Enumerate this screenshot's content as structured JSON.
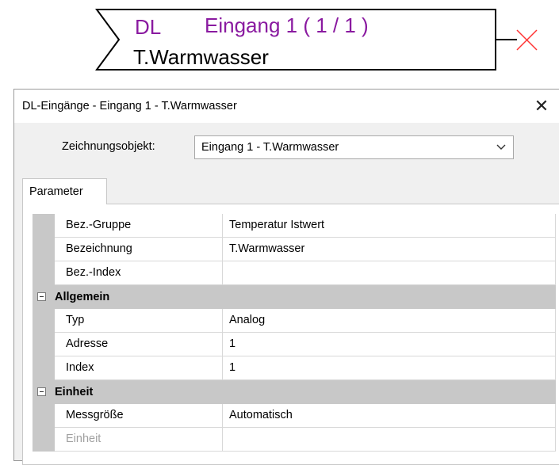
{
  "block": {
    "prefix": "DL",
    "title": "Eingang 1 ( 1 / 1 )",
    "name": "T.Warmwasser"
  },
  "dialog": {
    "title": "DL-Eingänge - Eingang 1 - T.Warmwasser",
    "close_icon": "✕",
    "drawing_object_label": "Zeichnungsobjekt:",
    "drawing_object_value": "Eingang 1 - T.Warmwasser",
    "tab_label": "Parameter"
  },
  "grid": {
    "rows": [
      {
        "type": "prop",
        "name": "Bez.-Gruppe",
        "value": "Temperatur Istwert"
      },
      {
        "type": "prop",
        "name": "Bezeichnung",
        "value": "T.Warmwasser"
      },
      {
        "type": "prop",
        "name": "Bez.-Index",
        "value": ""
      },
      {
        "type": "category",
        "name": "Allgemein"
      },
      {
        "type": "prop",
        "name": "Typ",
        "value": "Analog"
      },
      {
        "type": "prop",
        "name": "Adresse",
        "value": "1"
      },
      {
        "type": "prop",
        "name": "Index",
        "value": "1"
      },
      {
        "type": "category",
        "name": "Einheit"
      },
      {
        "type": "prop",
        "name": "Messgröße",
        "value": "Automatisch"
      },
      {
        "type": "prop",
        "name": "Einheit",
        "value": "",
        "disabled": true
      }
    ]
  },
  "colors": {
    "block_accent": "#8a1aa0",
    "unconnected_marker": "#ff3333"
  }
}
